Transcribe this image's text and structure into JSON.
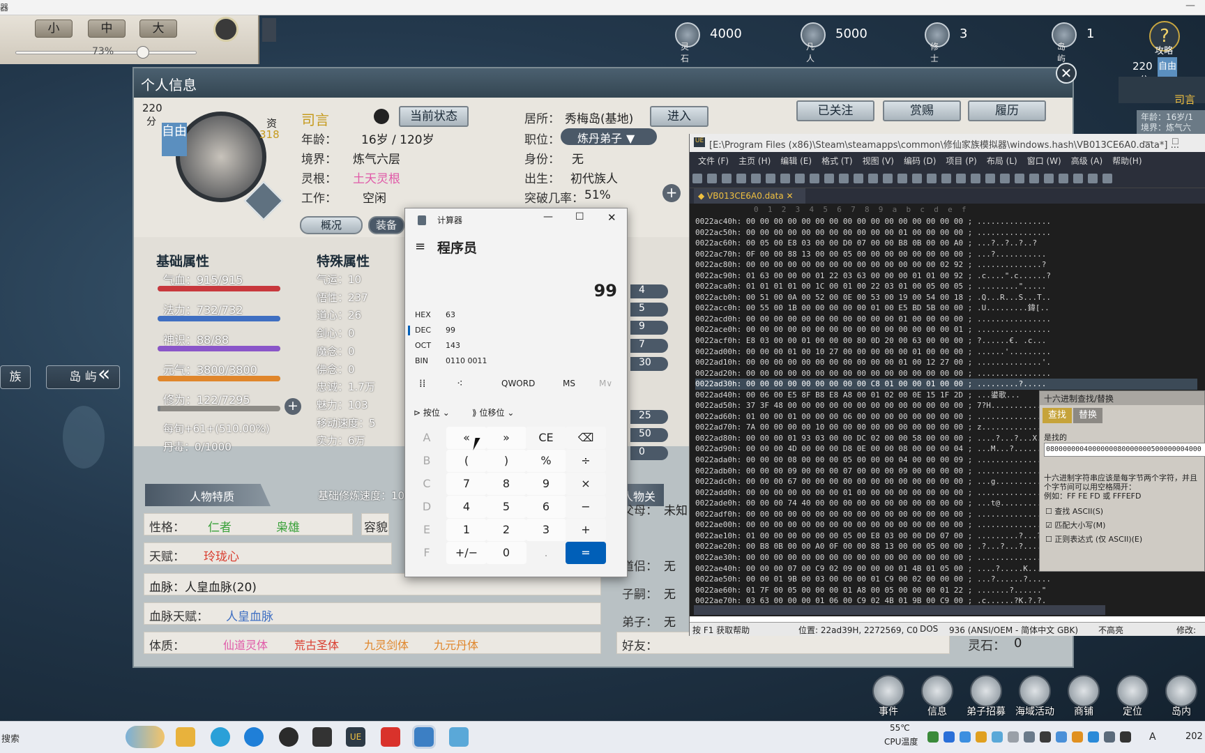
{
  "top_window": {
    "title_fragment": "器"
  },
  "zoom": {
    "sizes": [
      "小",
      "中",
      "大"
    ],
    "percent": "73%"
  },
  "resources": [
    {
      "label": "灵石",
      "value": "4000"
    },
    {
      "label": "凡人",
      "value": "5000"
    },
    {
      "label": "修士",
      "value": "3"
    },
    {
      "label": "岛屿",
      "value": "1"
    }
  ],
  "top_right": {
    "guide": "攻略",
    "score": "220",
    "score_unit": "分",
    "status": "自由",
    "name": "司言",
    "age_line": "年龄：16岁/1",
    "realm_line": "境界：炼气六"
  },
  "left_tabs": {
    "clan": "族",
    "island": "岛 屿"
  },
  "panel": {
    "title": "个人信息",
    "score": "220",
    "score_unit": "分",
    "status": "自由",
    "aptitude_label": "资",
    "aptitude_value": "318",
    "name": "司言",
    "current_status_btn": "当前状态",
    "age_label": "年龄：",
    "age_value": "16岁 / 120岁",
    "realm_label": "境界：",
    "realm_value": "炼气六层",
    "root_label": "灵根：",
    "root_value": "土天灵根",
    "work_label": "工作：",
    "work_value": "空闲",
    "residence_label": "居所：",
    "residence_value": "秀梅岛(基地)",
    "enter_btn": "进入",
    "post_label": "职位：",
    "post_value": "炼丹弟子",
    "identity_label": "身份：",
    "identity_value": "无",
    "birth_label": "出生：",
    "birth_value": "初代族人",
    "breakthrough_label": "突破几率：",
    "breakthrough_value": "51%",
    "follow_btn": "已关注",
    "reward_btn": "赏赐",
    "history_btn": "履历",
    "tab_overview": "概况",
    "tab_equip": "装备",
    "basic_title": "基础属性",
    "basic": [
      {
        "text": "气血：915/915",
        "color": "#c8383d",
        "fill": 1.0
      },
      {
        "text": "法力：732/732",
        "color": "#3f6fc2",
        "fill": 1.0
      },
      {
        "text": "神识：88/88",
        "color": "#8a56c9",
        "fill": 1.0
      },
      {
        "text": "元气：3800/3800",
        "color": "#e0862b",
        "fill": 1.0
      },
      {
        "text": "修为：122/7295",
        "color": "#7a7f84",
        "fill": 0.02
      }
    ],
    "per_month": "每旬+61+(510.00%)",
    "pill_poison": "丹毒：0/1000",
    "special_title": "特殊属性",
    "special": [
      "气运：10",
      "悟性：237",
      "道心：26",
      "剑心：0",
      "魔念：0",
      "佛念：0",
      "忠诚：1.7万",
      "魅力：103",
      "移动速度：5",
      "实力：6万"
    ],
    "extra_values": [
      "4",
      "5",
      "9",
      "7",
      "30",
      "25",
      "50",
      "0"
    ],
    "traits_title": "人物特质",
    "cultivation_speed": "基础修炼速度：10",
    "relations_title": "人物关",
    "personality_label": "性格：",
    "personality_1": "仁者",
    "personality_2": "枭雄",
    "appearance_label": "容貌",
    "talent_label": "天赋：",
    "talent_value": "玲珑心",
    "bloodline_text": "血脉：人皇血脉(20)",
    "bloodline_talent_label": "血脉天赋：",
    "bloodline_talent_value": "人皇血脉",
    "physique_label": "体质：",
    "physiques": [
      {
        "text": "仙道灵体",
        "color": "#e05aa8"
      },
      {
        "text": "荒古圣体",
        "color": "#d93c2e"
      },
      {
        "text": "九灵剑体",
        "color": "#e0862b"
      },
      {
        "text": "九元丹体",
        "color": "#e0862b"
      }
    ],
    "parents_label": "父母：",
    "parents_value": "未知",
    "partner_label": "道侣：",
    "partner_value": "无",
    "heir_label": "子嗣：",
    "heir_value": "无",
    "disciple_label": "弟子：",
    "disciple_value": "无",
    "friends_label": "好友：",
    "stones_label": "灵石：",
    "stones_value": "0"
  },
  "calculator": {
    "title": "计算器",
    "mode": "程序员",
    "display": "99",
    "hex_label": "HEX",
    "hex_value": "63",
    "dec_label": "DEC",
    "dec_value": "99",
    "oct_label": "OCT",
    "oct_value": "143",
    "bin_label": "BIN",
    "bin_value": "0110 0011",
    "word_size": "QWORD",
    "ms": "MS",
    "mv": "M∨",
    "bitwise": "按位",
    "bitshift": "位移位",
    "keys": [
      [
        "A",
        "«",
        "»",
        "CE",
        "⌫"
      ],
      [
        "B",
        "(",
        ")",
        "%",
        "÷"
      ],
      [
        "C",
        "7",
        "8",
        "9",
        "×"
      ],
      [
        "D",
        "4",
        "5",
        "6",
        "−"
      ],
      [
        "E",
        "1",
        "2",
        "3",
        "+"
      ],
      [
        "F",
        "+/−",
        "0",
        ".",
        "="
      ]
    ]
  },
  "hex_editor": {
    "title": "[E:\\Program Files (x86)\\Steam\\steamapps\\common\\修仙家族模拟器\\windows.hash\\VB013CE6A0.data*] ...",
    "menu": [
      "文件 (F)",
      "主页 (H)",
      "编辑 (E)",
      "格式 (T)",
      "视图 (V)",
      "编码 (D)",
      "项目 (P)",
      "布局 (L)",
      "窗口 (W)",
      "高级 (A)",
      "帮助(H)"
    ],
    "tab": "VB013CE6A0.data",
    "ruler": "0  1  2  3  4  5  6  7  8  9  a  b  c  d  e  f",
    "lines": [
      "0022ac40h: 00 00 00 00 00 00 00 00 00 00 00 00 00 00 00 00 ; ................",
      "0022ac50h: 00 00 00 00 00 00 00 00 00 00 00 01 00 00 00 00 ; ................",
      "0022ac60h: 00 05 00 E8 03 00 00 D0 07 00 00 B8 0B 00 00 A0 ; ...?..?..?..?",
      "0022ac70h: 0F 00 00 88 13 00 00 05 00 00 00 00 00 00 00 00 ; ...?...........",
      "0022ac80h: 00 00 00 00 00 00 00 00 00 00 00 00 00 00 02 92 ; ..............?",
      "0022ac90h: 01 63 00 00 00 01 22 03 63 00 00 00 01 01 00 92 ; .c....\".c......?",
      "0022aca0h: 01 01 01 01 00 1C 00 01 00 22 03 01 00 05 00 05 ; .........\".....",
      "0022acb0h: 00 51 00 0A 00 52 00 0E 00 53 00 19 00 54 00 18 ; .Q...R...S...T..",
      "0022acc0h: 00 55 00 1B 00 00 00 00 00 01 00 E5 BD 5B 00 00 ; .U.........鍏[..",
      "0022acd0h: 00 00 00 00 00 00 00 00 00 00 00 01 00 00 00 00 ; ................",
      "0022ace0h: 00 00 00 00 00 00 00 00 00 00 00 00 00 00 00 01 ; ................",
      "0022acf0h: E8 03 00 00 01 00 00 00 80 0D 20 00 63 00 00 00 ; ?......€. .c...",
      "0022ad00h: 00 00 00 01 00 10 27 00 00 00 00 00 01 00 00 00 ; ......'.........",
      "0022ad10h: 00 00 00 00 00 00 00 00 00 00 00 01 00 12 27 00 ; ..............'.",
      "0022ad20h: 00 00 00 00 00 00 00 00 00 00 00 00 00 00 00 00 ; ................",
      "0022ad30h: 00 00 00 00 00 00 00 00 00 C8 01 00 00 01 00 00 ; .........?.....",
      "0022ad40h: 00 06 00 E5 8F B8 E8 A8 00 01 02 00 0E 15 1F 2D ; ...鍙歌...",
      "0022ad50h: 37 3F 48 00 00 00 00 00 00 00 00 00 00 00 00 00 ; 7?H.............",
      "0022ad60h: 01 00 00 01 00 00 00 06 00 00 00 00 00 00 00 00 ; ................",
      "0022ad70h: 7A 00 00 00 00 10 00 00 00 00 00 00 00 00 00 00 ; z...............",
      "0022ad80h: 00 00 00 01 93 03 00 00 DC 02 00 00 58 00 00 00 ; ....?...?...X...",
      "0022ad90h: 00 00 00 4D 00 00 00 D8 0E 00 00 08 00 00 00 04 ; ...M...?.......",
      "0022ada0h: 00 00 00 08 00 00 00 05 00 00 00 04 00 00 00 09 ; ................",
      "0022adb0h: 00 00 00 09 00 00 00 07 00 00 00 09 00 00 00 00 ; ................",
      "0022adc0h: 00 00 00 67 00 00 00 00 00 00 00 00 00 00 00 00 ; ...g............",
      "0022add0h: 00 00 00 00 00 00 00 01 00 00 00 00 00 00 00 00 ; ................",
      "0022ade0h: 00 00 00 74 40 00 00 00 00 00 00 00 00 00 00 00 ; ...t@...........",
      "0022adf0h: 00 00 00 00 00 00 00 00 00 00 00 00 00 00 00 00 ; ................",
      "0022ae00h: 00 00 00 00 00 00 00 00 00 00 00 00 00 00 00 00 ; ................",
      "0022ae10h: 01 00 00 00 00 00 00 05 00 E8 03 00 00 D0 07 00 ; .........?...?.",
      "0022ae20h: 00 B8 0B 00 00 A0 0F 00 00 88 13 00 00 05 00 00 ; .?...?...?......",
      "0022ae30h: 00 00 00 00 00 00 00 00 00 00 00 00 00 00 00 00 ; ................",
      "0022ae40h: 00 00 00 07 00 C9 02 09 00 00 00 01 4B 01 05 00 ; ....?.....K...",
      "0022ae50h: 00 00 01 9B 00 03 00 00 00 01 C9 00 02 00 00 00 ; ...?......?.....",
      "0022ae60h: 01 7F 00 05 00 00 00 01 A8 00 05 00 00 00 01 22 ; .......?......\"",
      "0022ae70h: 03 63 00 00 00 01 06 00 C9 02 4B 01 9B 00 C9 00 ; .c......?K.?.?."
    ],
    "status_help": "按 F1 获取帮助",
    "status_pos": "位置: 22ad39H, 2272569, C0",
    "status_dos": "DOS",
    "status_enc": "936  (ANSI/OEM - 简体中文 GBK)",
    "status_hl": "不高亮",
    "status_mod": "修改:"
  },
  "find_dialog": {
    "title": "十六进制查找/替换",
    "tab_find": "查找",
    "tab_replace": "替换",
    "find_label": "是找的",
    "find_value": "0800000004000000080000000500000004000",
    "hint1": "十六进制字符串应该是每字节两个字符，并且",
    "hint2": "个字节间可以用空格隔开：",
    "hint3": "例如：FF FE FD 或 FFFEFD",
    "opt_ascii": "查找 ASCII(S)",
    "opt_case": "匹配大小写(M)",
    "opt_regex": "正则表达式 (仅 ASCII)(E)"
  },
  "bottom_icons": [
    "事件",
    "信息",
    "弟子招募",
    "海域活动",
    "商铺",
    "定位",
    "岛内"
  ],
  "taskbar": {
    "search": "搜索",
    "temp": "55℃",
    "temp_label": "CPU温度",
    "ime": "A",
    "clock": "202"
  }
}
